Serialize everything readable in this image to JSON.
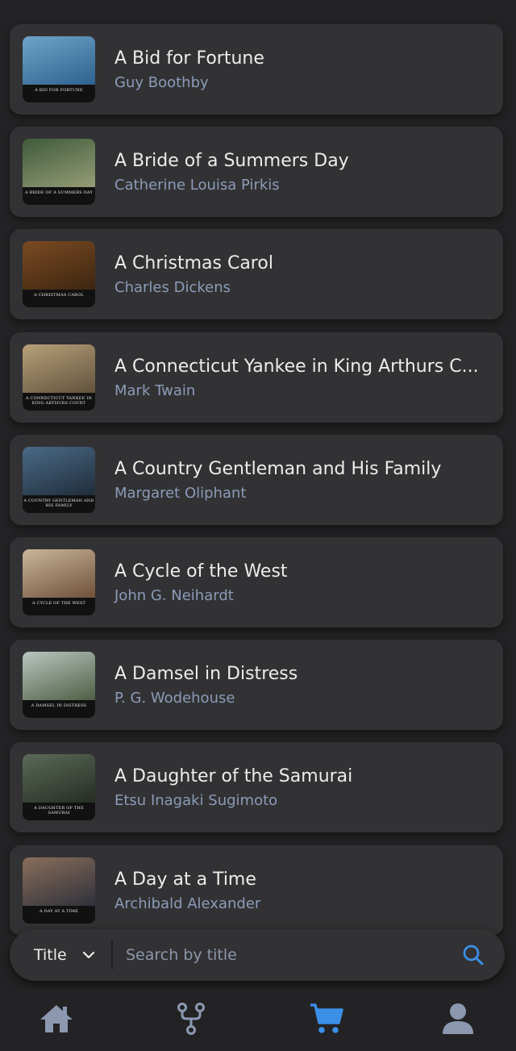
{
  "books": [
    {
      "title": "A Bid for Fortune",
      "author": "Guy Boothby",
      "cover_caption": "A Bid for Fortune",
      "cover_colors": [
        "#6fa3c8",
        "#2a5f8c"
      ]
    },
    {
      "title": "A Bride of a Summers Day",
      "author": "Catherine Louisa Pirkis",
      "cover_caption": "A Bride of a Summers Day",
      "cover_colors": [
        "#3e5a3a",
        "#9aa07a"
      ]
    },
    {
      "title": "A Christmas Carol",
      "author": "Charles Dickens",
      "cover_caption": "A Christmas Carol",
      "cover_colors": [
        "#7a4a22",
        "#3a2410"
      ]
    },
    {
      "title": "A Connecticut Yankee in King Arthurs C...",
      "author": "Mark Twain",
      "cover_caption": "A Connecticut Yankee in King Arthurs Court",
      "cover_colors": [
        "#b7a07a",
        "#5e4e3a"
      ]
    },
    {
      "title": "A Country Gentleman and His Family",
      "author": "Margaret Oliphant",
      "cover_caption": "A Country Gentleman and His Family",
      "cover_colors": [
        "#4a6a86",
        "#1e2a38"
      ]
    },
    {
      "title": "A Cycle of the West",
      "author": "John G. Neihardt",
      "cover_caption": "A Cycle of the West",
      "cover_colors": [
        "#c9b59a",
        "#6b4c36"
      ]
    },
    {
      "title": "A Damsel in Distress",
      "author": "P. G. Wodehouse",
      "cover_caption": "A Damsel in Distress",
      "cover_colors": [
        "#b8c6c0",
        "#4a5a3e"
      ]
    },
    {
      "title": "A Daughter of the Samurai",
      "author": "Etsu Inagaki Sugimoto",
      "cover_caption": "A Daughter of the Samurai",
      "cover_colors": [
        "#5a6a58",
        "#242a22"
      ]
    },
    {
      "title": "A Day at a Time",
      "author": "Archibald Alexander",
      "cover_caption": "A Day at a Time",
      "cover_colors": [
        "#8a6e5a",
        "#2a2e3a"
      ]
    }
  ],
  "search": {
    "field_label": "Title",
    "placeholder": "Search by title"
  },
  "nav": {
    "active": "cart"
  },
  "colors": {
    "accent": "#3b8fe6",
    "inactive_icon": "#8c98b0",
    "card": "#323234",
    "background": "#232325"
  }
}
